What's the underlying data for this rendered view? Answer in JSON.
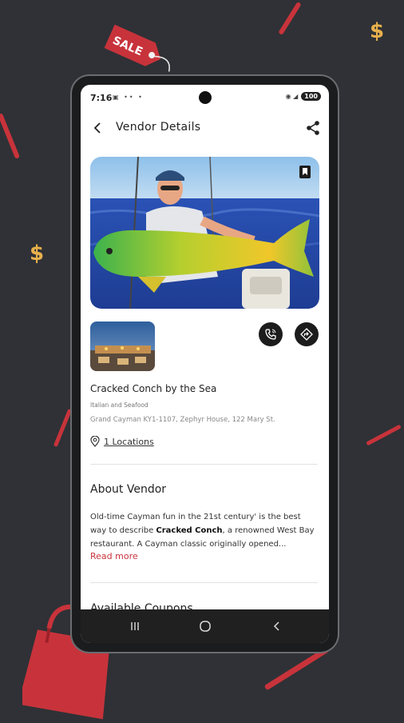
{
  "status": {
    "time": "7:16",
    "left_icons": "▣ •• •",
    "right_icons": "◉ ◢",
    "battery": "100"
  },
  "appbar": {
    "title": "Vendor Details"
  },
  "vendor": {
    "name": "Cracked Conch by the Sea",
    "category": "Italian and Seafood",
    "address": "Grand Cayman KY1-1107, Zephyr House, 122 Mary St.",
    "locations": "1 Locations"
  },
  "about": {
    "title": "About Vendor",
    "text_before": "Old-time Cayman fun in the 21st century' is the best way to describe ",
    "text_bold": "Cracked Conch",
    "text_after": ", a renowned West Bay restaurant. A Cayman classic originally opened...",
    "read_more": "Read more"
  },
  "coupons": {
    "title": "Available Coupons"
  },
  "promo": {
    "sale_tag": "SALE",
    "dollar": "$"
  },
  "colors": {
    "accent": "#c8333b",
    "background": "#2f3136",
    "gold": "#e8b04c"
  }
}
